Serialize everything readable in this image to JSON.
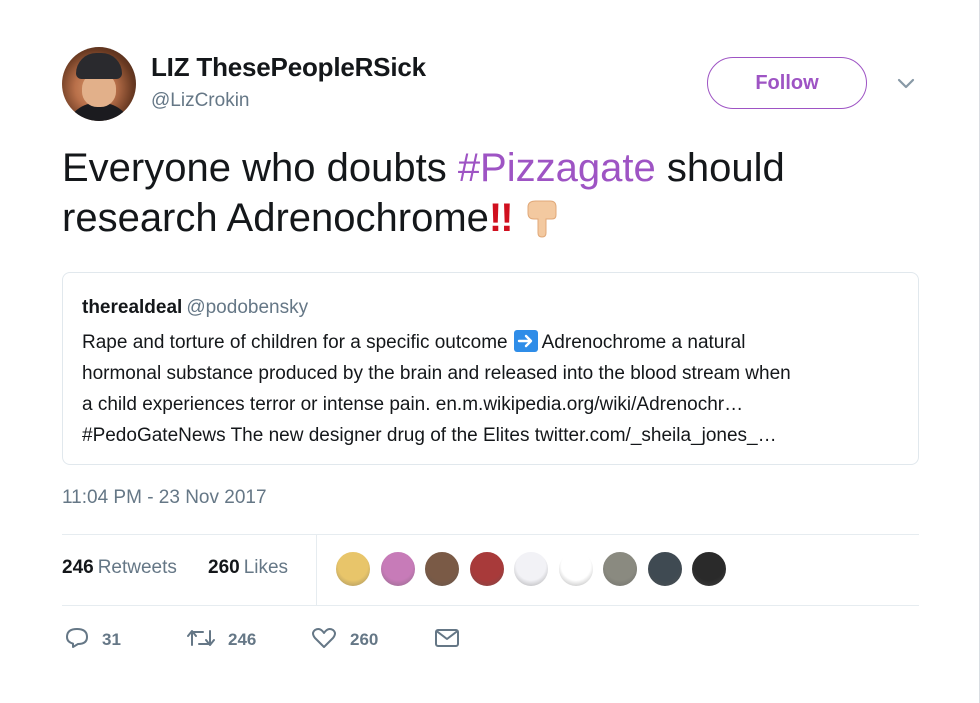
{
  "author": {
    "display_name": "LIZ ThesePeopleRSick",
    "handle": "@LizCrokin"
  },
  "follow_label": "Follow",
  "tweet": {
    "text_part1": "Everyone who doubts ",
    "hashtag": "#Pizzagate",
    "text_part2": " should research Adrenochrome",
    "emphasis": "!!"
  },
  "quote": {
    "name": "therealdeal",
    "handle": "@podobensky",
    "line1_a": "Rape and torture of children for a specific outcome",
    "line1_b": "Adrenochrome a natural",
    "line2": "hormonal  substance produced by the brain and released into the blood stream when",
    "line3": "a child experiences terror or intense pain. en.m.wikipedia.org/wiki/Adrenochr…",
    "line4": "#PedoGateNews  The new designer drug of the Elites twitter.com/_sheila_jones_…"
  },
  "timestamp": "11:04 PM - 23 Nov 2017",
  "stats": {
    "retweets_count": "246",
    "retweets_label": "Retweets",
    "likes_count": "260",
    "likes_label": "Likes"
  },
  "likers": [
    {
      "name": "liker-avatar-1",
      "color": "#e8c56a"
    },
    {
      "name": "liker-avatar-2",
      "color": "#c77bb8"
    },
    {
      "name": "liker-avatar-3",
      "color": "#7a5a46"
    },
    {
      "name": "liker-avatar-4",
      "color": "#a83a3a"
    },
    {
      "name": "liker-avatar-5",
      "color": "#f2f2f6"
    },
    {
      "name": "liker-avatar-6",
      "color": "#ffffff"
    },
    {
      "name": "liker-avatar-7",
      "color": "#8a8a80"
    },
    {
      "name": "liker-avatar-8",
      "color": "#3f4a52"
    },
    {
      "name": "liker-avatar-9",
      "color": "#2a2a2a"
    }
  ],
  "actions": {
    "reply_count": "31",
    "retweet_count": "246",
    "like_count": "260"
  },
  "colors": {
    "accent": "#9e54c4",
    "secondary_text": "#657786",
    "primary_text": "#14171a"
  }
}
